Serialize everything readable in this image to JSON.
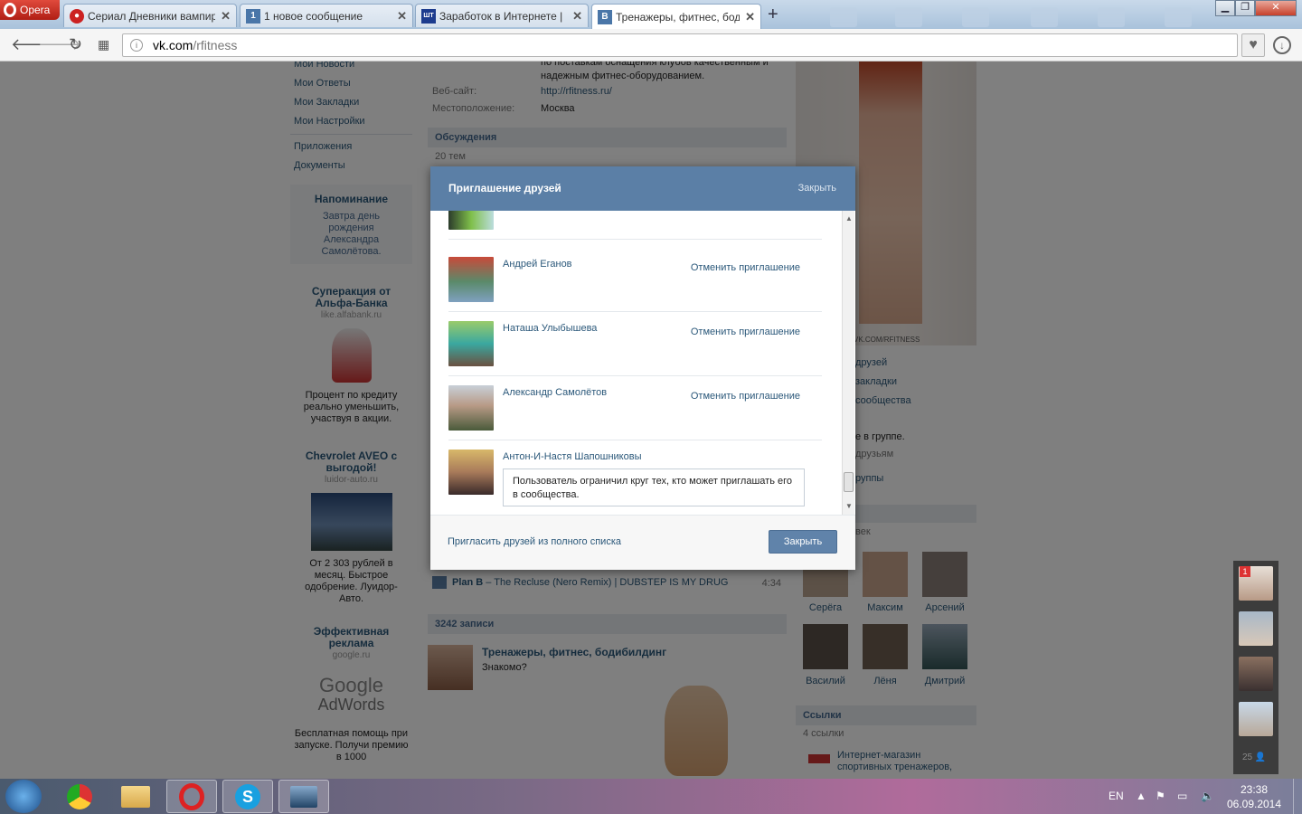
{
  "browser": {
    "menu_label": "Opera",
    "tabs": [
      {
        "title": "Сериал Дневники вампиро",
        "icon": "vampire-icon",
        "active": false
      },
      {
        "title": "1 новое сообщение",
        "icon": "vk-icon",
        "active": false
      },
      {
        "title": "Заработок в Интернете |",
        "icon": "shtz-icon",
        "active": false
      },
      {
        "title": "Тренажеры, фитнес, бодибил",
        "icon": "vk-icon",
        "active": true
      }
    ],
    "url_host": "vk.com",
    "url_path": "/rfitness"
  },
  "page": {
    "left_nav": [
      "Мои Новости",
      "Мои Ответы",
      "Мои Закладки",
      "Мои Настройки",
      "Приложения",
      "Документы"
    ],
    "reminder": {
      "title": "Напоминание",
      "text": "Завтра день рождения Александра Самолётова."
    },
    "ads": [
      {
        "title": "Суперакция от Альфа-Банка",
        "domain": "like.alfabank.ru",
        "text": "Процент по кредиту реально уменьшить, участвуя в акции."
      },
      {
        "title": "Chevrolet AVEO с выгодой!",
        "domain": "luidor-auto.ru",
        "text": "От 2 303 рублей в месяц. Быстрое одобрение. Луидор-Авто."
      },
      {
        "title": "Эффективная реклама",
        "domain": "google.ru",
        "text": "Бесплатная помощь при запуске. Получи премию в 1000"
      }
    ],
    "adwords_logo": "Google",
    "adwords_sub": "AdWords",
    "description_tail": "по поставкам оснащения клубов качественным и надежным фитнес-оборудованием.",
    "website_label": "Веб-сайт:",
    "website_value": "http://rfitness.ru/",
    "location_label": "Местоположение:",
    "location_value": "Москва",
    "discussions_title": "Обсуждения",
    "discussions_count": "20 тем",
    "audio_track_artist": "Plan B",
    "audio_track_title": " – The Recluse (Nero Remix) | DUBSTEP IS MY DRUG",
    "audio_track_time": "4:34",
    "posts_count": "3242 записи",
    "post_author": "Тренажеры, фитнес, бодибилдинг",
    "post_text": "Знакомо?",
    "right_links": [
      "друзей",
      "закладки",
      "сообщества"
    ],
    "group_status": "е в группе.",
    "group_friends": "друзьям",
    "group_link": "руппы",
    "members_suffix": "век",
    "members": [
      "Серёга",
      "Максим",
      "Арсений",
      "Василий",
      "Лёня",
      "Дмитрий"
    ],
    "links_title": "Ссылки",
    "links_count": "4 ссылки",
    "link_item": "Интернет-магазин спортивных тренажеров,",
    "vk_photo_caption": "VK.COM/RFITNESS"
  },
  "dialog": {
    "title": "Приглашение друзей",
    "close_link": "Закрыть",
    "friends": [
      {
        "name": "Андрей Еганов",
        "action": "Отменить приглашение"
      },
      {
        "name": "Наташа Улыбышева",
        "action": "Отменить приглашение"
      },
      {
        "name": "Александр Самолётов",
        "action": "Отменить приглашение"
      },
      {
        "name": "Антон-И-Настя Шапошниковы",
        "note": "Пользователь ограничил круг тех, кто может приглашать его в сообщества."
      }
    ],
    "invite_all": "Пригласить друзей из полного списка",
    "close_button": "Закрыть"
  },
  "notifications": {
    "badge": "1",
    "count": "25"
  },
  "taskbar": {
    "lang": "EN",
    "time": "23:38",
    "date": "06.09.2014"
  }
}
